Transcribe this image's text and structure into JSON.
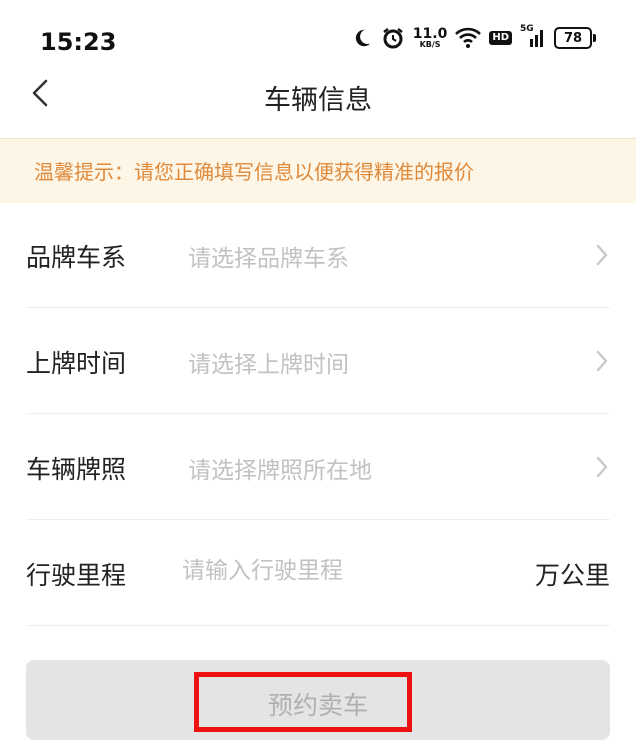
{
  "status_bar": {
    "time": "15:23",
    "net_speed_value": "11.0",
    "net_speed_unit": "KB/S",
    "hd_label": "HD",
    "network_label": "5G",
    "battery_level": "78",
    "icons": [
      "moon-icon",
      "alarm-icon",
      "wifi-icon",
      "hd-icon",
      "signal-icon",
      "battery-icon"
    ]
  },
  "nav": {
    "title": "车辆信息",
    "back_icon": "chevron-left-icon"
  },
  "tip": {
    "text": "温馨提示：请您正确填写信息以便获得精准的报价",
    "color": "#e08a3c",
    "background": "#fdf6e6"
  },
  "form": {
    "rows": [
      {
        "label": "品牌车系",
        "placeholder": "请选择品牌车系",
        "chevron": "chevron-right-icon"
      },
      {
        "label": "上牌时间",
        "placeholder": "请选择上牌时间",
        "chevron": "chevron-right-icon"
      },
      {
        "label": "车辆牌照",
        "placeholder": "请选择牌照所在地",
        "chevron": "chevron-right-icon"
      }
    ],
    "mileage": {
      "label": "行驶里程",
      "placeholder": "请输入行驶里程",
      "value": "",
      "unit": "万公里"
    }
  },
  "submit": {
    "label": "预约卖车",
    "highlight_color": "#ee1111"
  }
}
